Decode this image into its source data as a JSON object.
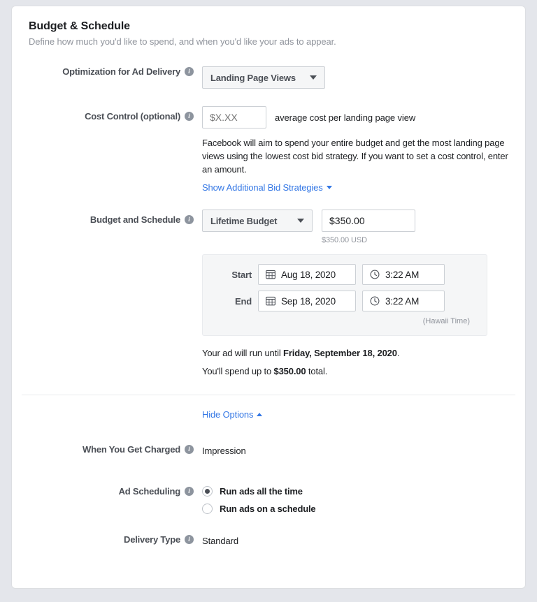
{
  "card": {
    "title": "Budget & Schedule",
    "subtitle": "Define how much you'd like to spend, and when you'd like your ads to appear."
  },
  "optimization": {
    "label": "Optimization for Ad Delivery",
    "selected": "Landing Page Views",
    "info_icon": "info-icon",
    "caret_icon": "chevron-down-icon"
  },
  "cost_control": {
    "label": "Cost Control (optional)",
    "placeholder": "$X.XX",
    "value": "",
    "unit_text": "average cost per landing page view",
    "help_text": "Facebook will aim to spend your entire budget and get the most landing page views using the lowest cost bid strategy. If you want to set a cost control, enter an amount.",
    "link_text": "Show Additional Bid Strategies"
  },
  "budget": {
    "label": "Budget and Schedule",
    "type_selected": "Lifetime Budget",
    "amount": "$350.00",
    "currency_note": "$350.00 USD"
  },
  "schedule": {
    "start_label": "Start",
    "start_date": "Aug 18, 2020",
    "start_time": "3:22 AM",
    "end_label": "End",
    "end_date": "Sep 18, 2020",
    "end_time": "3:22 AM",
    "timezone_note": "(Hawaii Time)",
    "calendar_icon": "calendar-icon",
    "clock_icon": "clock-icon"
  },
  "summary": {
    "run_prefix": "Your ad will run until ",
    "run_date": "Friday, September 18, 2020",
    "run_suffix": ".",
    "spend_prefix": "You'll spend up to ",
    "spend_amount": "$350.00",
    "spend_suffix": " total."
  },
  "options_toggle": {
    "label": "Hide Options",
    "caret_icon": "chevron-up-icon"
  },
  "when_charged": {
    "label": "When You Get Charged",
    "value": "Impression"
  },
  "ad_scheduling": {
    "label": "Ad Scheduling",
    "options": [
      {
        "label": "Run ads all the time",
        "selected": true
      },
      {
        "label": "Run ads on a schedule",
        "selected": false
      }
    ]
  },
  "delivery_type": {
    "label": "Delivery Type",
    "value": "Standard"
  },
  "colors": {
    "link_blue": "#3578e5",
    "label_gray": "#4b4f56",
    "muted_gray": "#90949c",
    "panel_bg": "#f5f6f7"
  }
}
